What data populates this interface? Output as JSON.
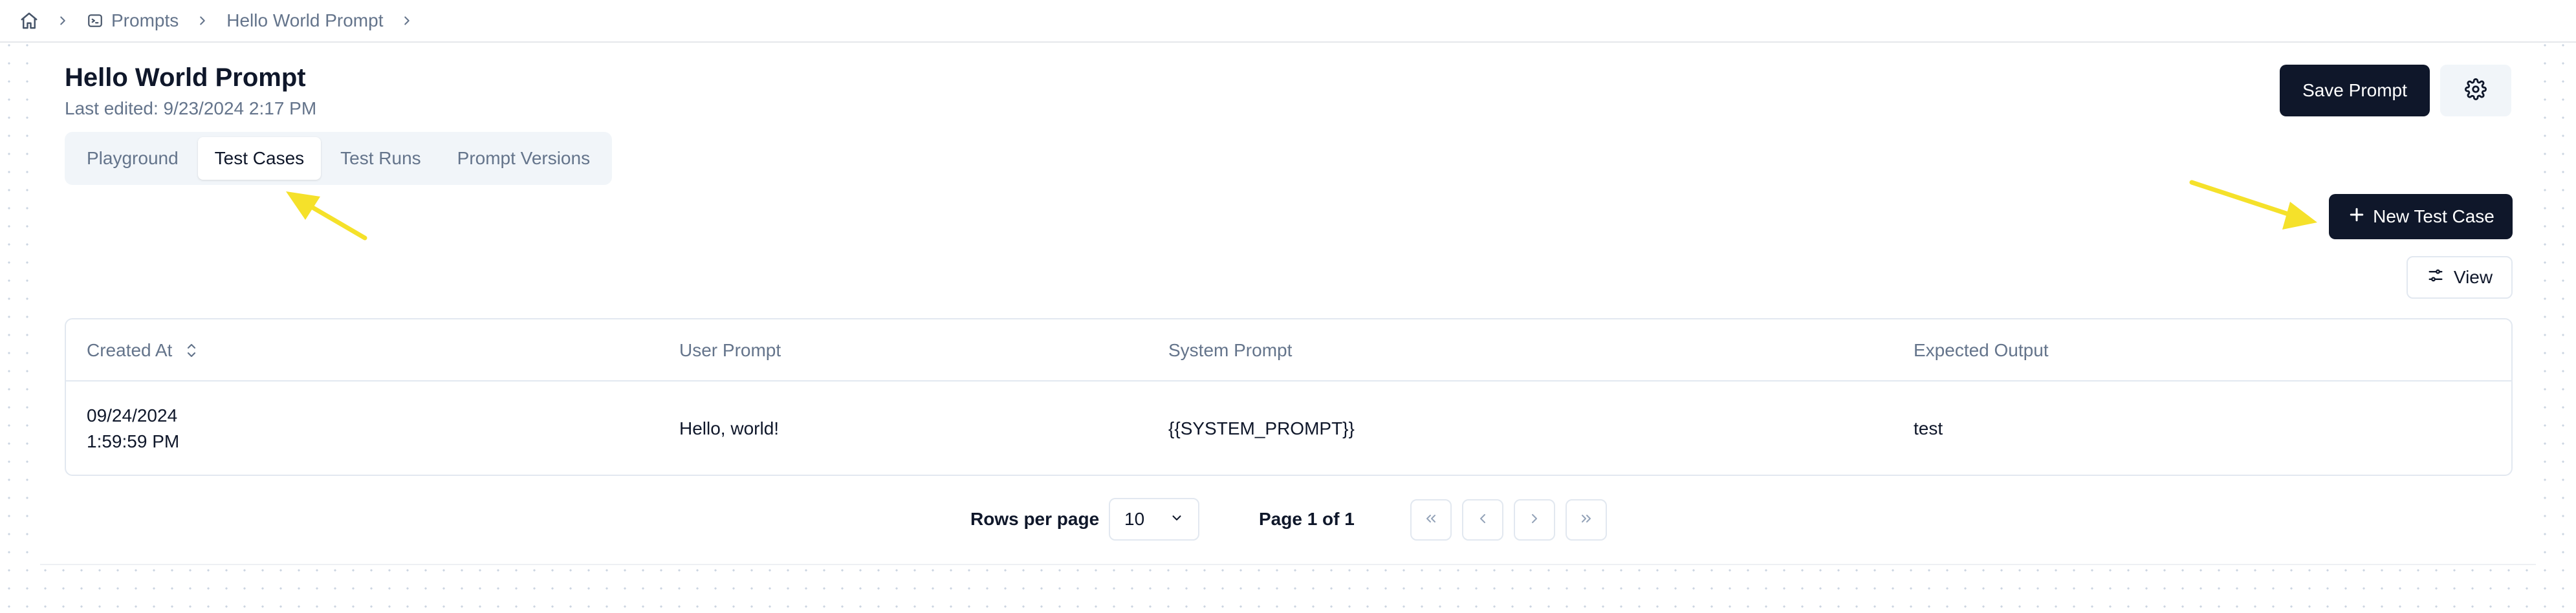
{
  "breadcrumb": {
    "items": [
      {
        "label": "Prompts"
      },
      {
        "label": "Hello World Prompt"
      }
    ]
  },
  "header": {
    "title": "Hello World Prompt",
    "subtitle": "Last edited: 9/23/2024 2:17 PM",
    "save_label": "Save Prompt"
  },
  "tabs": [
    {
      "label": "Playground",
      "active": false
    },
    {
      "label": "Test Cases",
      "active": true
    },
    {
      "label": "Test Runs",
      "active": false
    },
    {
      "label": "Prompt Versions",
      "active": false
    }
  ],
  "actions": {
    "new_test_case_label": "New Test Case",
    "view_label": "View"
  },
  "table": {
    "columns": [
      "Created At",
      "User Prompt",
      "System Prompt",
      "Expected Output"
    ],
    "rows": [
      {
        "created_date": "09/24/2024",
        "created_time": "1:59:59 PM",
        "user_prompt": "Hello, world!",
        "system_prompt": "{{SYSTEM_PROMPT}}",
        "expected_output": "test"
      }
    ]
  },
  "pagination": {
    "rows_per_page_label": "Rows per page",
    "rows_per_page_value": "10",
    "page_label": "Page 1 of 1"
  },
  "colors": {
    "primary": "#0f172a",
    "muted_text": "#64748b",
    "border": "#e2e8f0",
    "annotation_arrow": "#f5e12a"
  },
  "icons": [
    "home-icon",
    "chevron-right-icon",
    "terminal-icon",
    "gear-icon",
    "plus-icon",
    "sliders-icon",
    "sort-icon",
    "chevron-down-icon",
    "chevrons-left-icon",
    "chevron-left-icon",
    "chevrons-right-icon"
  ]
}
